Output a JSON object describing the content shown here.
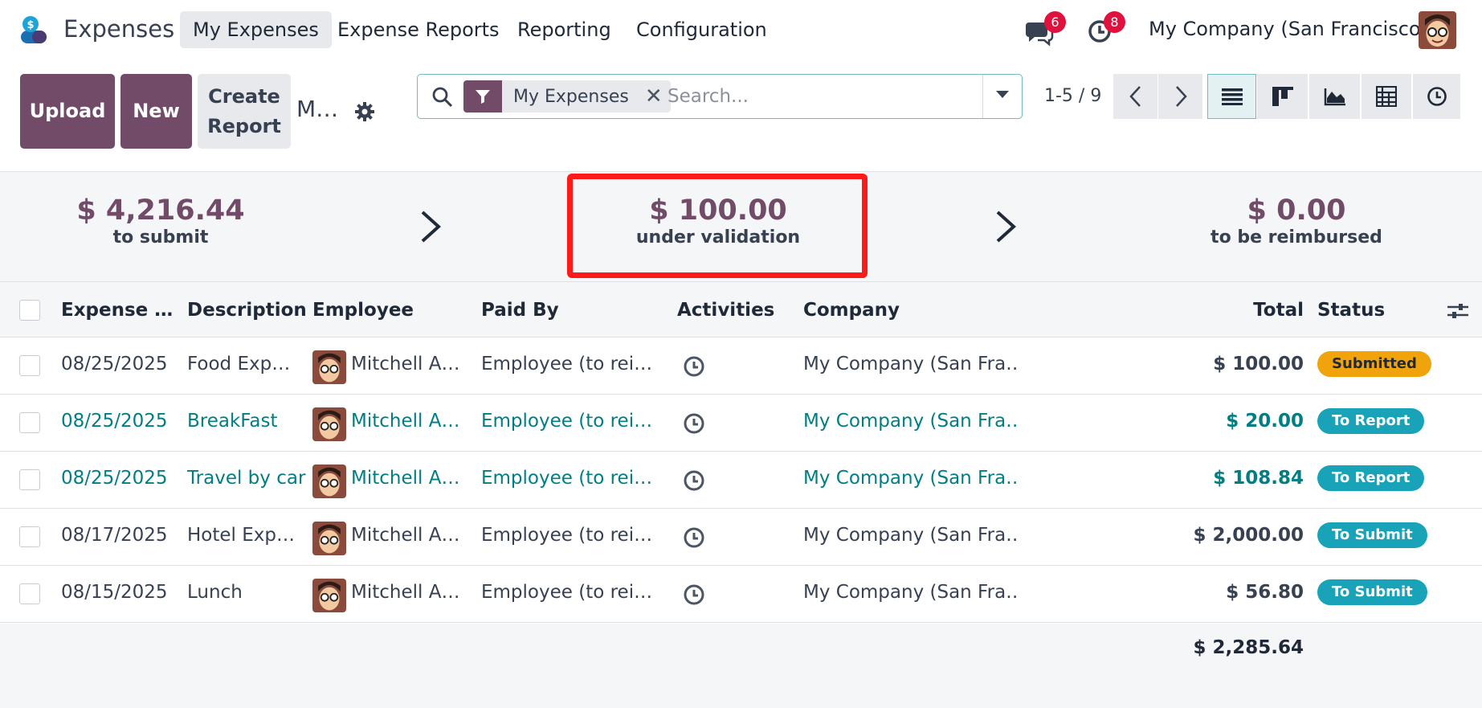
{
  "app": {
    "name": "Expenses"
  },
  "menu": [
    "My Expenses",
    "Expense Reports",
    "Reporting",
    "Configuration"
  ],
  "systray": {
    "messages_count": "6",
    "activities_count": "8",
    "company": "My Company (San Francisco)"
  },
  "actions": {
    "upload": "Upload",
    "new": "New",
    "create_report": "Create Report"
  },
  "breadcrumb": "M…",
  "search": {
    "facet": "My Expenses",
    "placeholder": "Search..."
  },
  "pager": {
    "value": "1-5 / 9"
  },
  "stats": [
    {
      "amount": "$ 4,216.44",
      "label": "to submit"
    },
    {
      "amount": "$ 100.00",
      "label": "under validation"
    },
    {
      "amount": "$ 0.00",
      "label": "to be reimbursed"
    }
  ],
  "table": {
    "headers": {
      "date": "Expense …",
      "description": "Description",
      "employee": "Employee",
      "paid_by": "Paid By",
      "activities": "Activities",
      "company": "Company",
      "total": "Total",
      "status": "Status"
    },
    "rows": [
      {
        "date": "08/25/2025",
        "description": "Food Exp…",
        "employee": "Mitchell A…",
        "paid_by": "Employee (to rei…",
        "company": "My Company (San Fra…",
        "total": "$ 100.00",
        "status": "Submitted"
      },
      {
        "date": "08/25/2025",
        "description": "BreakFast",
        "employee": "Mitchell A…",
        "paid_by": "Employee (to rei…",
        "company": "My Company (San Fra…",
        "total": "$ 20.00",
        "status": "To Report"
      },
      {
        "date": "08/25/2025",
        "description": "Travel by car",
        "employee": "Mitchell A…",
        "paid_by": "Employee (to rei…",
        "company": "My Company (San Fra…",
        "total": "$ 108.84",
        "status": "To Report"
      },
      {
        "date": "08/17/2025",
        "description": "Hotel Exp…",
        "employee": "Mitchell A…",
        "paid_by": "Employee (to rei…",
        "company": "My Company (San Fra…",
        "total": "$ 2,000.00",
        "status": "To Submit"
      },
      {
        "date": "08/15/2025",
        "description": "Lunch",
        "employee": "Mitchell A…",
        "paid_by": "Employee (to rei…",
        "company": "My Company (San Fra…",
        "total": "$ 56.80",
        "status": "To Submit"
      }
    ],
    "grand_total": "$ 2,285.64"
  },
  "colors": {
    "brand": "#714b67",
    "link": "#017e84",
    "submitted": "#f0a30a",
    "status_blue": "#18a3b8",
    "highlight": "#ff1a1a"
  },
  "icons": [
    "expenses-app-icon",
    "chat-icon",
    "clock-icon",
    "search-icon",
    "filter-icon",
    "gear-icon",
    "list-view-icon",
    "kanban-view-icon",
    "graph-view-icon",
    "pivot-view-icon",
    "activity-view-icon",
    "optional-columns-icon"
  ]
}
